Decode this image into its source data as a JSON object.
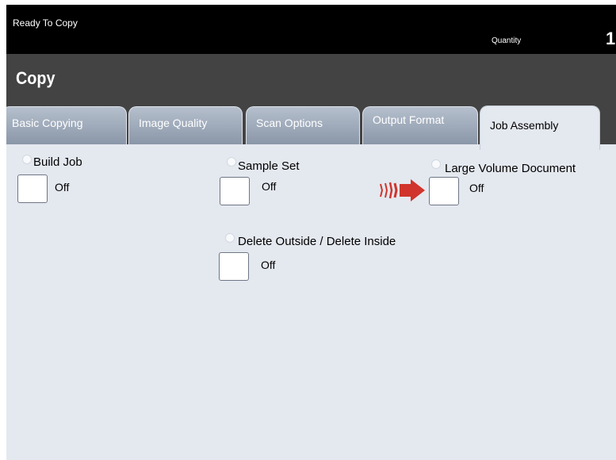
{
  "header": {
    "status": "Ready To Copy",
    "quantity_label": "Quantity",
    "quantity_value": "1"
  },
  "title": "Copy",
  "tabs": [
    {
      "label": "Basic Copying",
      "active": false
    },
    {
      "label": "Image Quality",
      "active": false
    },
    {
      "label": "Scan Options",
      "active": false
    },
    {
      "label": "Output Format",
      "active": false
    },
    {
      "label": "Job Assembly",
      "active": true
    }
  ],
  "options": {
    "build_job": {
      "label": "Build Job",
      "value": "Off"
    },
    "sample_set": {
      "label": "Sample Set",
      "value": "Off"
    },
    "large_volume": {
      "label": "Large Volume Document",
      "value": "Off"
    },
    "delete_outside": {
      "label": "Delete Outside / Delete Inside",
      "value": "Off"
    }
  },
  "colors": {
    "accent_arrow": "#d0342c",
    "title_bar": "#434343",
    "panel": "#e4e8ef"
  }
}
